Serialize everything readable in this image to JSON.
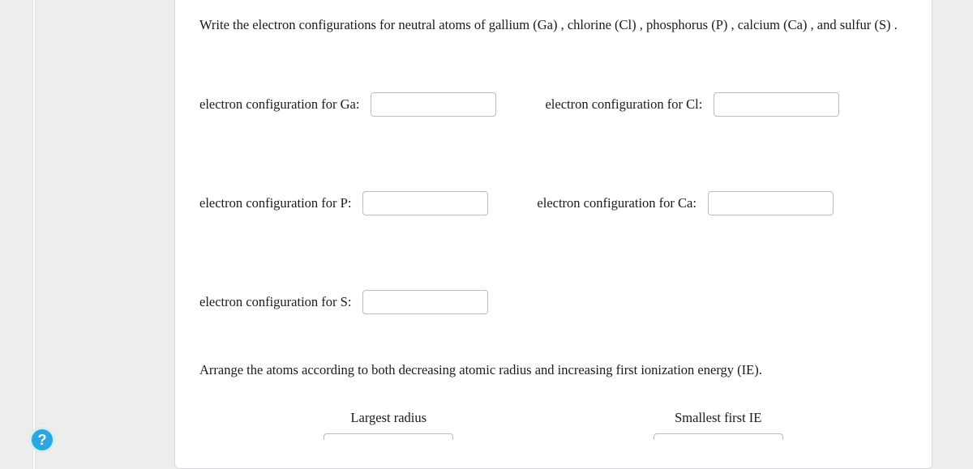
{
  "prompt": "Write the electron configurations for neutral atoms of gallium (Ga) , chlorine (Cl) , phosphorus (P) , calcium (Ca) , and sulfur (S) .",
  "fields": {
    "ga": {
      "label": "electron configuration for Ga:",
      "value": ""
    },
    "cl": {
      "label": "electron configuration for Cl:",
      "value": ""
    },
    "p": {
      "label": "electron configuration for P:",
      "value": ""
    },
    "ca": {
      "label": "electron configuration for Ca:",
      "value": ""
    },
    "s": {
      "label": "electron configuration for S:",
      "value": ""
    }
  },
  "arrange_prompt": "Arrange the atoms according to both decreasing atomic radius and increasing first ionization energy (IE).",
  "rank": {
    "left_label": "Largest radius",
    "right_label": "Smallest first IE"
  },
  "help": {
    "label": "?"
  }
}
